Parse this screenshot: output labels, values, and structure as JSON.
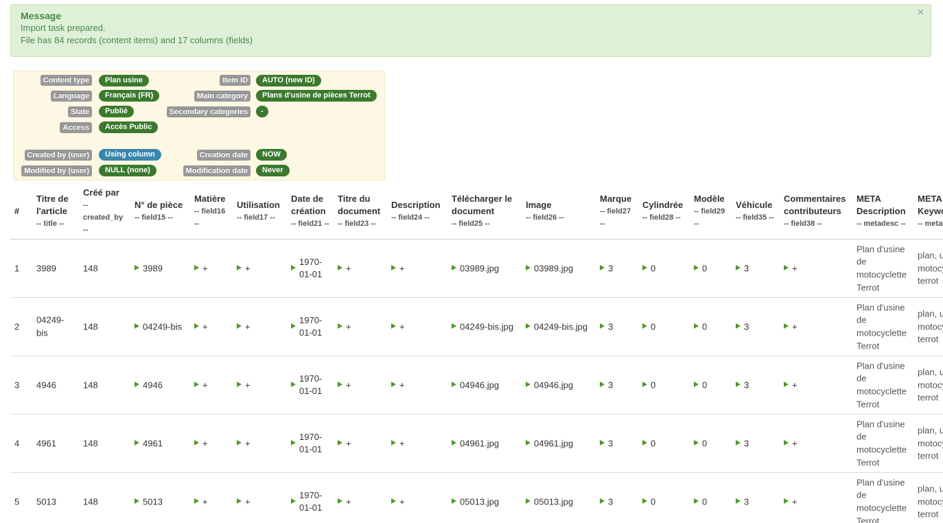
{
  "alert": {
    "title": "Message",
    "line1": "Import task prepared.",
    "line2": "File has 84 records (content items) and 17 columns (fields)",
    "close": "×"
  },
  "settings": {
    "content_type": {
      "label": "Content type",
      "value": "Plan usine"
    },
    "language": {
      "label": "Language",
      "value": "Français (FR)"
    },
    "state": {
      "label": "State",
      "value": "Publié"
    },
    "access": {
      "label": "Access",
      "value": "Accès Public"
    },
    "item_id": {
      "label": "Item ID",
      "value": "AUTO (new ID)"
    },
    "main_category": {
      "label": "Main category",
      "value": "Plans d'usine de pièces Terrot"
    },
    "secondary_categories": {
      "label": "Secondary categories",
      "value": "-"
    },
    "created_by": {
      "label": "Created by (user)",
      "value": "Using column"
    },
    "modified_by": {
      "label": "Modified by (user)",
      "value": "NULL (none)"
    },
    "creation_date": {
      "label": "Creation date",
      "value": "NOW"
    },
    "modification_date": {
      "label": "Modification date",
      "value": "Never"
    }
  },
  "table": {
    "columns": [
      {
        "title": "#",
        "sub": ""
      },
      {
        "title": "Titre de l'article",
        "sub": "-- title --"
      },
      {
        "title": "Créé par",
        "sub": "-- created_by --"
      },
      {
        "title": "N° de pièce",
        "sub": "-- field15 --"
      },
      {
        "title": "Matière",
        "sub": "-- field16 --"
      },
      {
        "title": "Utilisation",
        "sub": "-- field17 --"
      },
      {
        "title": "Date de création",
        "sub": "-- field21 --"
      },
      {
        "title": "Titre du document",
        "sub": "-- field23 --"
      },
      {
        "title": "Description",
        "sub": "-- field24 --"
      },
      {
        "title": "Télécharger le document",
        "sub": "-- field25 --"
      },
      {
        "title": "Image",
        "sub": "-- field26 --"
      },
      {
        "title": "Marque",
        "sub": "-- field27 --"
      },
      {
        "title": "Cylindrée",
        "sub": "-- field28 --"
      },
      {
        "title": "Modèle",
        "sub": "-- field29 --"
      },
      {
        "title": "Véhicule",
        "sub": "-- field35 --"
      },
      {
        "title": "Commentaires contributeurs",
        "sub": "-- field38 --"
      },
      {
        "title": "META Description",
        "sub": "-- metadesc --"
      },
      {
        "title": "META Keywords",
        "sub": "-- metakey --"
      }
    ],
    "rows": [
      [
        "1",
        "3989",
        "148",
        "3989",
        "+",
        "+",
        "1970-01-01",
        "+",
        "+",
        "03989.jpg",
        "03989.jpg",
        "3",
        "0",
        "0",
        "3",
        "+",
        "Plan d'usine de motocyclette Terrot",
        "plan, usine, motocyclette, terrot"
      ],
      [
        "2",
        "04249-bis",
        "148",
        "04249-bis",
        "+",
        "+",
        "1970-01-01",
        "+",
        "+",
        "04249-bis.jpg",
        "04249-bis.jpg",
        "3",
        "0",
        "0",
        "3",
        "+",
        "Plan d'usine de motocyclette Terrot",
        "plan, usine, motocyclette, terrot"
      ],
      [
        "3",
        "4946",
        "148",
        "4946",
        "+",
        "+",
        "1970-01-01",
        "+",
        "+",
        "04946.jpg",
        "04946.jpg",
        "3",
        "0",
        "0",
        "3",
        "+",
        "Plan d'usine de motocyclette Terrot",
        "plan, usine, motocyclette, terrot"
      ],
      [
        "4",
        "4961",
        "148",
        "4961",
        "+",
        "+",
        "1970-01-01",
        "+",
        "+",
        "04961.jpg",
        "04961.jpg",
        "3",
        "0",
        "0",
        "3",
        "+",
        "Plan d'usine de motocyclette Terrot",
        "plan, usine, motocyclette, terrot"
      ],
      [
        "5",
        "5013",
        "148",
        "5013",
        "+",
        "+",
        "1970-01-01",
        "+",
        "+",
        "05013.jpg",
        "05013.jpg",
        "3",
        "0",
        "0",
        "3",
        "+",
        "Plan d'usine de motocyclette Terrot",
        "plan, usine, motocyclette, terrot"
      ]
    ]
  }
}
